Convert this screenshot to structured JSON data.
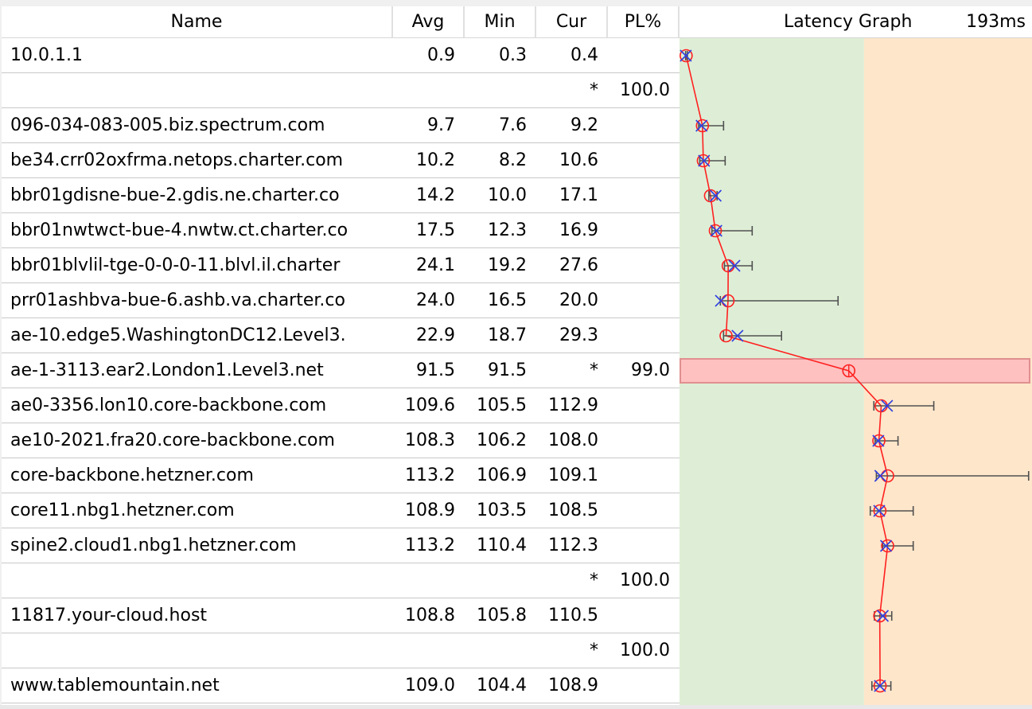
{
  "columns": {
    "name": "Name",
    "avg": "Avg",
    "min": "Min",
    "cur": "Cur",
    "pl": "PL%",
    "graph": "Latency Graph",
    "graph_max": "193ms"
  },
  "graph_scale": {
    "max_ms": 193,
    "green_until_ms": 100,
    "colors": {
      "green_zone": "#deeed6",
      "orange_zone": "#fde6ca",
      "loss_band": "#ffc0c0",
      "line": "#ff2020",
      "cross": "#3040e0",
      "whisker": "#505050"
    }
  },
  "hops": [
    {
      "name": "10.0.1.1",
      "avg": "0.9",
      "min": "0.3",
      "cur": "0.4",
      "pl": "",
      "marker_ms": 0.6,
      "cross_ms": 0.4,
      "wmin_ms": 0.3,
      "wmax_ms": 1.3
    },
    {
      "name": "",
      "avg": "",
      "min": "",
      "cur": "*",
      "pl": "100.0"
    },
    {
      "name": "096-034-083-005.biz.spectrum.com",
      "avg": "9.7",
      "min": "7.6",
      "cur": "9.2",
      "pl": "",
      "marker_ms": 9.7,
      "cross_ms": 9.2,
      "wmin_ms": 7.6,
      "wmax_ms": 21.5
    },
    {
      "name": "be34.crr02oxfrma.netops.charter.com",
      "avg": "10.2",
      "min": "8.2",
      "cur": "10.6",
      "pl": "",
      "marker_ms": 10.2,
      "cross_ms": 10.6,
      "wmin_ms": 8.2,
      "wmax_ms": 22.4
    },
    {
      "name": "bbr01gdisne-bue-2.gdis.ne.charter.co",
      "avg": "14.2",
      "min": "10.0",
      "cur": "17.1",
      "pl": "",
      "marker_ms": 14.2,
      "cross_ms": 17.1,
      "wmin_ms": 13.3,
      "wmax_ms": 17.9
    },
    {
      "name": "bbr01nwtwct-bue-4.nwtw.ct.charter.co",
      "avg": "17.5",
      "min": "12.3",
      "cur": "16.9",
      "pl": "",
      "marker_ms": 16.9,
      "cross_ms": 17.5,
      "wmin_ms": 15.0,
      "wmax_ms": 37.5
    },
    {
      "name": "bbr01blvlil-tge-0-0-0-11.blvl.il.charter",
      "avg": "24.1",
      "min": "19.2",
      "cur": "27.6",
      "pl": "",
      "marker_ms": 24.1,
      "cross_ms": 27.6,
      "wmin_ms": 22.0,
      "wmax_ms": 37.5
    },
    {
      "name": "prr01ashbva-bue-6.ashb.va.charter.co",
      "avg": "24.0",
      "min": "16.5",
      "cur": "20.0",
      "pl": "",
      "marker_ms": 24.0,
      "cross_ms": 20.0,
      "wmin_ms": 19.7,
      "wmax_ms": 85.5
    },
    {
      "name": "ae-10.edge5.WashingtonDC12.Level3.",
      "avg": "22.9",
      "min": "18.7",
      "cur": "29.3",
      "pl": "",
      "marker_ms": 22.9,
      "cross_ms": 29.3,
      "wmin_ms": 21.5,
      "wmax_ms": 53.9
    },
    {
      "name": "ae-1-3113.ear2.London1.Level3.net",
      "avg": "91.5",
      "min": "91.5",
      "cur": "*",
      "pl": "99.0",
      "marker_ms": 91.5,
      "loss": true
    },
    {
      "name": "ae0-3356.lon10.core-backbone.com",
      "avg": "109.6",
      "min": "105.5",
      "cur": "112.9",
      "pl": "",
      "marker_ms": 109.6,
      "cross_ms": 112.9,
      "wmin_ms": 105.5,
      "wmax_ms": 139.0
    },
    {
      "name": "ae10-2021.fra20.core-backbone.com",
      "avg": "108.3",
      "min": "106.2",
      "cur": "108.0",
      "pl": "",
      "marker_ms": 108.3,
      "cross_ms": 108.0,
      "wmin_ms": 106.2,
      "wmax_ms": 119.0
    },
    {
      "name": "core-backbone.hetzner.com",
      "avg": "113.2",
      "min": "106.9",
      "cur": "109.1",
      "pl": "",
      "marker_ms": 113.2,
      "cross_ms": 109.1,
      "wmin_ms": 106.9,
      "wmax_ms": 192.0
    },
    {
      "name": "core11.nbg1.hetzner.com",
      "avg": "108.9",
      "min": "103.5",
      "cur": "108.5",
      "pl": "",
      "marker_ms": 108.9,
      "cross_ms": 108.5,
      "wmin_ms": 103.5,
      "wmax_ms": 127.5
    },
    {
      "name": "spine2.cloud1.nbg1.hetzner.com",
      "avg": "113.2",
      "min": "110.4",
      "cur": "112.3",
      "pl": "",
      "marker_ms": 113.2,
      "cross_ms": 112.3,
      "wmin_ms": 110.4,
      "wmax_ms": 127.5
    },
    {
      "name": "",
      "avg": "",
      "min": "",
      "cur": "*",
      "pl": "100.0"
    },
    {
      "name": "11817.your-cloud.host",
      "avg": "108.8",
      "min": "105.8",
      "cur": "110.5",
      "pl": "",
      "marker_ms": 108.8,
      "cross_ms": 110.5,
      "wmin_ms": 105.8,
      "wmax_ms": 115.5
    },
    {
      "name": "",
      "avg": "",
      "min": "",
      "cur": "*",
      "pl": "100.0"
    },
    {
      "name": "www.tablemountain.net",
      "avg": "109.0",
      "min": "104.4",
      "cur": "108.9",
      "pl": "",
      "marker_ms": 109.0,
      "cross_ms": 108.9,
      "wmin_ms": 104.4,
      "wmax_ms": 115.0
    }
  ]
}
